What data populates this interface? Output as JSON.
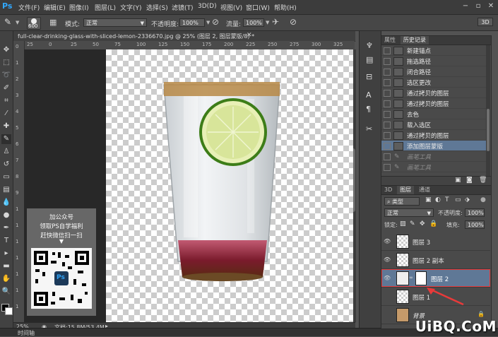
{
  "app": {
    "logo": "Ps"
  },
  "menu": [
    "文件(F)",
    "编辑(E)",
    "图像(I)",
    "图层(L)",
    "文字(Y)",
    "选择(S)",
    "滤镜(T)",
    "3D(D)",
    "视图(V)",
    "窗口(W)",
    "帮助(H)"
  ],
  "options": {
    "brush_size": "600",
    "mode_label": "模式:",
    "mode_value": "正常",
    "opacity_label": "不透明度:",
    "opacity_value": "100%",
    "flow_label": "流量:",
    "flow_value": "100%",
    "workspace": "3D"
  },
  "document": {
    "tab_title": "full-clear-drinking-glass-with-sliced-lemon-2336670.jpg @ 25% (图层 2, 图层蒙版/8) *",
    "ruler_top": [
      "25",
      "0",
      "25",
      "50",
      "75",
      "100",
      "125",
      "150",
      "175",
      "200",
      "225",
      "250",
      "275",
      "300",
      "325"
    ],
    "ruler_left": [
      "0",
      "1",
      "2",
      "3",
      "4",
      "5",
      "6",
      "7",
      "8",
      "9",
      "1",
      "1",
      "1",
      "1",
      "1",
      "1",
      "1"
    ],
    "zoom": "25%",
    "doc_size": "文档:15.8M/53.4M"
  },
  "promo": {
    "line1": "加公众号",
    "line2": "领取PS自学福利",
    "line3": "赶快微信扫一扫",
    "arrow": "▼",
    "badge": "Ps"
  },
  "history": {
    "tabs": [
      "属性",
      "历史记录"
    ],
    "active_tab": 1,
    "items": [
      {
        "label": "新建锚点",
        "state": "normal"
      },
      {
        "label": "拖选路径",
        "state": "normal"
      },
      {
        "label": "闭合路径",
        "state": "normal"
      },
      {
        "label": "选区更改",
        "state": "normal"
      },
      {
        "label": "通过拷贝的图层",
        "state": "normal"
      },
      {
        "label": "通过拷贝的图层",
        "state": "normal"
      },
      {
        "label": "去色",
        "state": "normal"
      },
      {
        "label": "载入选区",
        "state": "normal"
      },
      {
        "label": "通过拷贝的图层",
        "state": "normal"
      },
      {
        "label": "添加图层蒙版",
        "state": "selected"
      },
      {
        "label": "画笔工具",
        "state": "dim"
      },
      {
        "label": "画笔工具",
        "state": "dim"
      }
    ]
  },
  "layers": {
    "tabs": [
      "3D",
      "图层",
      "通道"
    ],
    "active_tab": 1,
    "kind_label": "类型",
    "blend_mode": "正常",
    "opacity_label": "不透明度:",
    "opacity_value": "100%",
    "lock_label": "锁定:",
    "fill_label": "填充:",
    "fill_value": "100%",
    "items": [
      {
        "name": "图层 3",
        "visible": true,
        "selected": false
      },
      {
        "name": "图层 2 副本",
        "visible": true,
        "selected": false
      },
      {
        "name": "图层 2",
        "visible": true,
        "selected": true
      },
      {
        "name": "图层 1",
        "visible": false,
        "selected": false
      },
      {
        "name": "背景",
        "visible": false,
        "selected": false
      }
    ]
  },
  "timeline": {
    "label": "时间轴"
  },
  "watermark": "UiBQ.CoM",
  "colors": {
    "highlight": "#e83a3a",
    "selection": "#5f7896",
    "ps_blue": "#31a8ff"
  }
}
